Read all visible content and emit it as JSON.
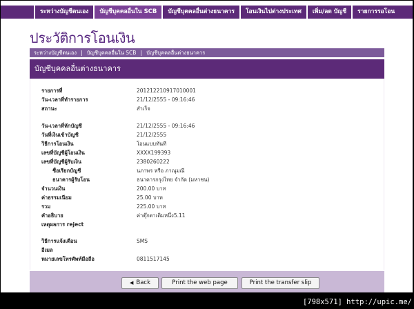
{
  "nav": {
    "tabs": [
      "ระหว่างบัญชีตนเอง",
      "บัญชีบุคคลอื่นใน SCB",
      "บัญชีบุคคลอื่นต่างธนาคาร",
      "โอนเงินไปต่างประเทศ",
      "เพิ่ม/ลด บัญชี",
      "รายการรอโอน"
    ]
  },
  "page_title": "ประวัติการโอนเงิน",
  "subtabs": [
    "ระหว่างบัญชีตนเอง",
    "บัญชีบุคคลอื่นใน SCB",
    "บัญชีบุคคลอื่นต่างธนาคาร"
  ],
  "panel_title": "บัญชีบุคคลอื่นต่างธนาคาร",
  "details": {
    "ref_label": "รายการที่",
    "ref_value": "201212210917010001",
    "txn_time_label": "วัน-เวลาที่ทำรายการ",
    "txn_time_value": "21/12/2555 - 09:16:46",
    "status_label": "สถานะ",
    "status_value": "สำเร็จ",
    "debit_time_label": "วัน-เวลาที่หักบัญชี",
    "debit_time_value": "21/12/2555 - 09:16:46",
    "credit_date_label": "วันที่เงินเข้าบัญชี",
    "credit_date_value": "21/12/2555",
    "method_label": "วิธีการโอนเงิน",
    "method_value": "โอนแบบทันที",
    "from_acct_label": "เลขที่บัญชีผู้โอนเงิน",
    "from_acct_value": "XXXX199393",
    "to_acct_label": "เลขที่บัญชีผู้รับเงิน",
    "to_acct_value": "2380260222",
    "acct_name_label": "ชื่อเรียกบัญชี",
    "acct_name_value": "นภาพร หรือ ภาณุมณี",
    "bank_label": "ธนาคารผู้รับโอน",
    "bank_value": "ธนาคารกรุงไทย จำกัด (มหาชน)",
    "amount_label": "จำนวนเงิน",
    "amount_value": "200.00  บาท",
    "fee_label": "ค่าธรรมเนียม",
    "fee_value": "25.00  บาท",
    "total_label": "รวม",
    "total_value": "225.00  บาท",
    "desc_label": "คำอธิบาย",
    "desc_value": "ค่าตุ๊กตาเติมหนึ่ง5.11",
    "reject_label": "เหตุผลการ reject",
    "reject_value": "",
    "notify_label": "วิธีการแจ้งเตือน",
    "notify_value": "SMS",
    "email_label": "อีเมล",
    "email_value": "",
    "mobile_label": "หมายเลขโทรศัพท์มือถือ",
    "mobile_value": "0811517145"
  },
  "buttons": {
    "back": "Back",
    "print_page": "Print the web page",
    "print_slip": "Print the transfer slip"
  },
  "watermark": "[798x571] http://upic.me/"
}
